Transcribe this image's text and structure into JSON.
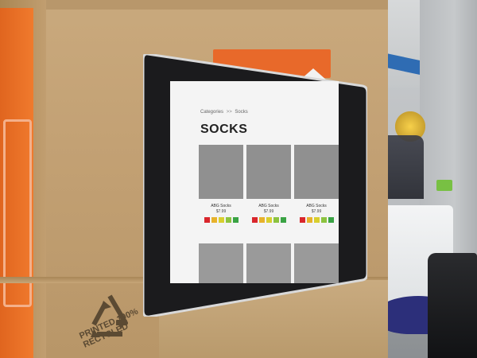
{
  "screen": {
    "breadcrumb": {
      "root": "Categories",
      "separator": ">>",
      "current": "Socks"
    },
    "page_title": "SOCKS",
    "products": [
      {
        "name": "ABG Socks",
        "price": "$7.99",
        "swatches": [
          "#d9262c",
          "#e7b22b",
          "#d8cf2e",
          "#8cc33f",
          "#3aa344"
        ]
      },
      {
        "name": "ABG Socks",
        "price": "$7.99",
        "swatches": [
          "#d9262c",
          "#e7b22b",
          "#d8cf2e",
          "#8cc33f",
          "#3aa344"
        ]
      },
      {
        "name": "ABG Socks",
        "price": "$7.99",
        "swatches": [
          "#d9262c",
          "#e7b22b",
          "#d8cf2e",
          "#8cc33f",
          "#3aa344"
        ]
      }
    ]
  },
  "box": {
    "recycle_text": "PRINTED 100% RECYCLED"
  }
}
